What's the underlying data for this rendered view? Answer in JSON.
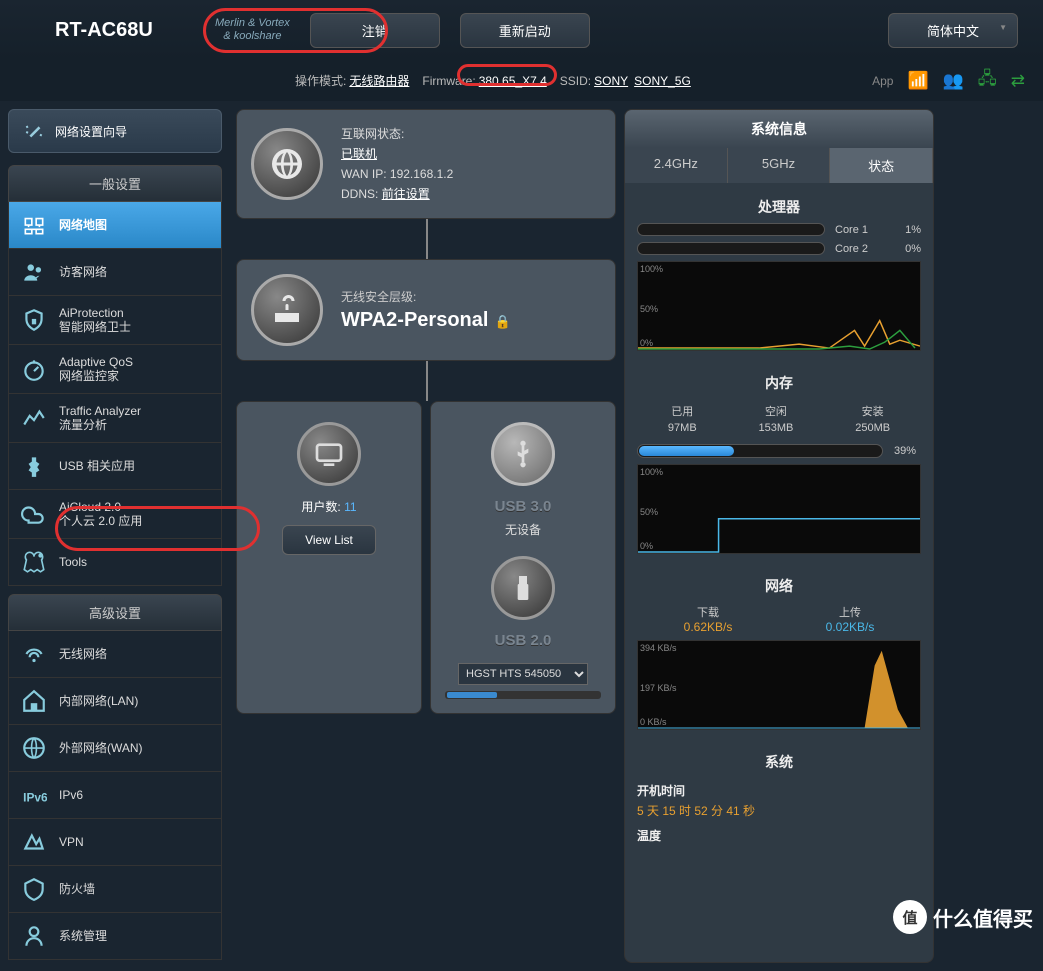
{
  "header": {
    "model": "RT-AC68U",
    "tagline1": "Merlin & Vortex",
    "tagline2": "& koolshare",
    "logout": "注销",
    "reboot": "重新启动",
    "lang": "简体中文"
  },
  "infobar": {
    "opmode_label": "操作模式:",
    "opmode": "无线路由器",
    "fw_label": "Firmware:",
    "fw": "380.65_X7.4",
    "ssid_label": "SSID:",
    "ssid1": "SONY",
    "ssid2": "SONY_5G",
    "app": "App"
  },
  "sidebar": {
    "wizard": "网络设置向导",
    "general_hdr": "一般设置",
    "general": [
      {
        "label": "网络地图",
        "sub": ""
      },
      {
        "label": "访客网络",
        "sub": ""
      },
      {
        "label": "AiProtection",
        "sub": "智能网络卫士"
      },
      {
        "label": "Adaptive QoS",
        "sub": "网络监控家"
      },
      {
        "label": "Traffic Analyzer",
        "sub": "流量分析"
      },
      {
        "label": "USB 相关应用",
        "sub": ""
      },
      {
        "label": "AiCloud 2.0",
        "sub": "个人云 2.0 应用"
      },
      {
        "label": "Tools",
        "sub": ""
      }
    ],
    "adv_hdr": "高级设置",
    "adv": [
      {
        "label": "无线网络"
      },
      {
        "label": "内部网络(LAN)"
      },
      {
        "label": "外部网络(WAN)"
      },
      {
        "label": "IPv6"
      },
      {
        "label": "VPN"
      },
      {
        "label": "防火墙"
      },
      {
        "label": "系统管理"
      }
    ]
  },
  "net": {
    "status_label": "互联网状态:",
    "status": "已联机",
    "wan_label": "WAN IP:",
    "wan": "192.168.1.2",
    "ddns_label": "DDNS:",
    "ddns": "前往设置"
  },
  "wifi": {
    "sec_label": "无线安全层级:",
    "sec": "WPA2-Personal"
  },
  "clients": {
    "label": "用户数:",
    "count": "11",
    "view": "View List"
  },
  "usb": {
    "p1": "USB 3.0",
    "p1s": "无设备",
    "p2": "USB 2.0",
    "disk": "HGST HTS 545050"
  },
  "sys": {
    "title": "系统信息",
    "tabs": [
      "2.4GHz",
      "5GHz",
      "状态"
    ],
    "cpu_hdr": "处理器",
    "cores": [
      {
        "name": "Core 1",
        "val": "1%"
      },
      {
        "name": "Core 2",
        "val": "0%"
      }
    ],
    "mem_hdr": "内存",
    "mem": {
      "used_l": "已用",
      "used": "97MB",
      "free_l": "空闲",
      "free": "153MB",
      "total_l": "安装",
      "total": "250MB",
      "pct": "39%"
    },
    "net_hdr": "网络",
    "dl_l": "下载",
    "dl": "0.62KB/s",
    "ul_l": "上传",
    "ul": "0.02KB/s",
    "y1": "394 KB/s",
    "y2": "197 KB/s",
    "y3": "0 KB/s",
    "sys_hdr": "系统",
    "uptime_l": "开机时间",
    "uptime": "5 天 15 时 52 分 41 秒",
    "temp_l": "温度"
  },
  "watermark": "什么值得买"
}
